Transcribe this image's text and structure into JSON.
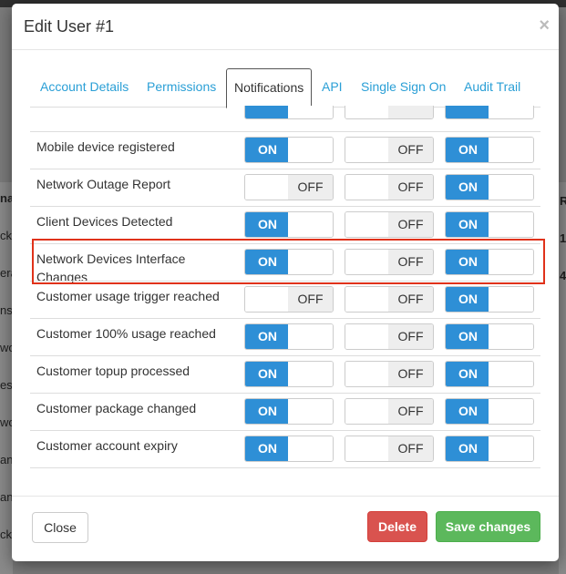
{
  "background_app": {
    "left_fragments": [
      "na",
      "ck",
      "era",
      "nsi",
      "wo",
      "es",
      "wo",
      "and",
      "and",
      "ck"
    ],
    "right_fragments": [
      "R",
      "1",
      "4"
    ]
  },
  "modal": {
    "title": "Edit User #1",
    "close_symbol": "×"
  },
  "tabs": [
    {
      "label": "Account Details",
      "active": false
    },
    {
      "label": "Permissions",
      "active": false
    },
    {
      "label": "Notifications",
      "active": true
    },
    {
      "label": "API",
      "active": false
    },
    {
      "label": "Single Sign On",
      "active": false
    },
    {
      "label": "Audit Trail",
      "active": false
    }
  ],
  "toggle_labels": {
    "on": "ON",
    "off": "OFF"
  },
  "partial_top_row": [
    "on",
    "off",
    "on"
  ],
  "notifications": [
    {
      "label": "Mobile device registered",
      "channels": [
        "on",
        "off",
        "on"
      ]
    },
    {
      "label": "Network Outage Report",
      "channels": [
        "off",
        "off",
        "on"
      ]
    },
    {
      "label": "Client Devices Detected",
      "channels": [
        "on",
        "off",
        "on"
      ]
    },
    {
      "label": "Network Devices Interface Changes",
      "channels": [
        "on",
        "off",
        "on"
      ],
      "highlighted": true
    },
    {
      "label": "Customer usage trigger reached",
      "channels": [
        "off",
        "off",
        "on"
      ]
    },
    {
      "label": "Customer 100% usage reached",
      "channels": [
        "on",
        "off",
        "on"
      ]
    },
    {
      "label": "Customer topup processed",
      "channels": [
        "on",
        "off",
        "on"
      ]
    },
    {
      "label": "Customer package changed",
      "channels": [
        "on",
        "off",
        "on"
      ]
    },
    {
      "label": "Customer account expiry",
      "channels": [
        "on",
        "off",
        "on"
      ]
    }
  ],
  "footer": {
    "close_label": "Close",
    "delete_label": "Delete",
    "save_label": "Save changes"
  },
  "colors": {
    "on": "#2e8fd6",
    "link": "#2a9fd6",
    "highlight": "#e0321a",
    "delete": "#d9534f",
    "save": "#5cb85c"
  }
}
